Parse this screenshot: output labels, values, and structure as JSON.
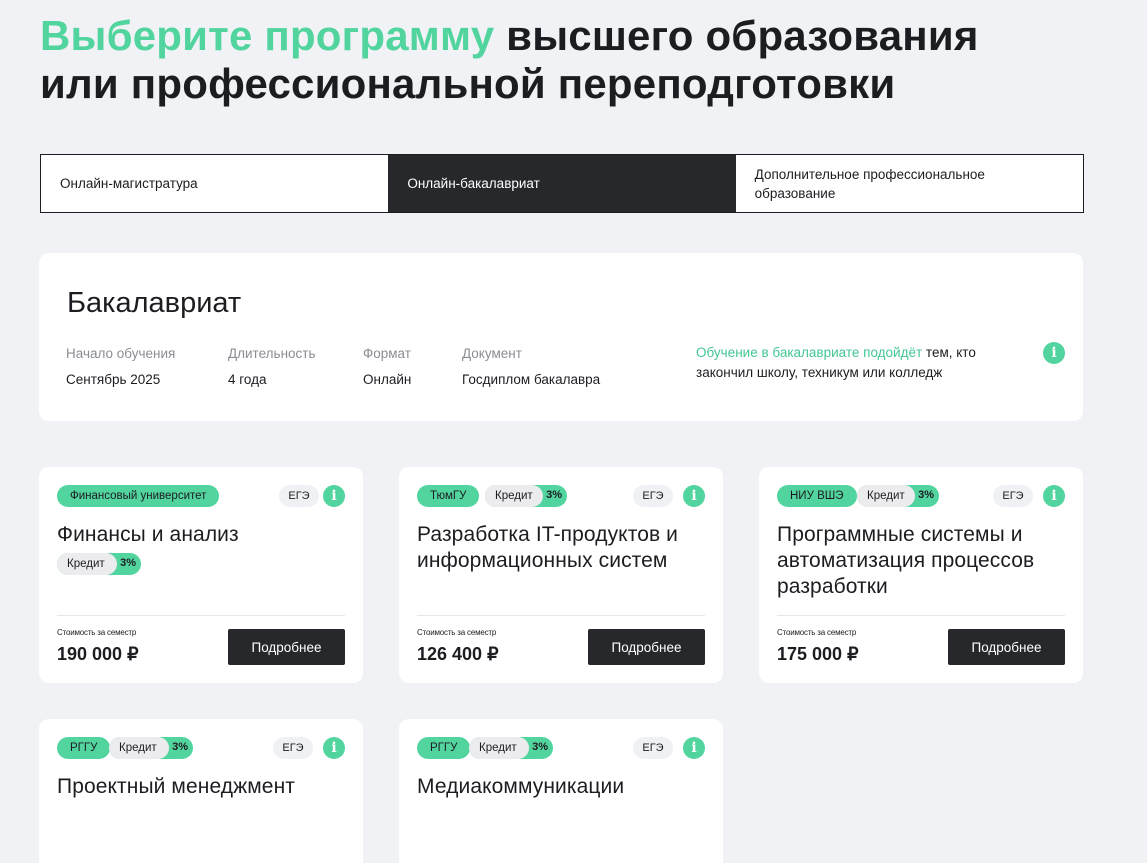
{
  "hero": {
    "accent": "Выберите программу",
    "line1_rest": " высшего образования",
    "line2": "или профессиональной переподготовки"
  },
  "tabs": [
    {
      "label": "Онлайн-магистратура",
      "active": false
    },
    {
      "label": "Онлайн-бакалавриат",
      "active": true
    },
    {
      "label": "Дополнительное профессиональное образование",
      "active": false
    }
  ],
  "program": {
    "title": "Бакалавриат",
    "start_label": "Начало обучения",
    "start_value": "Сентябрь 2025",
    "duration_label": "Длительность",
    "duration_value": "4 года",
    "format_label": "Формат",
    "format_value": "Онлайн",
    "document_label": "Документ",
    "document_value": "Госдиплом бакалавра",
    "suits_highlight": "Обучение в бакалавриате подойдёт",
    "suits_rest": " тем, кто закончил школу, техникум или колледж",
    "info_glyph": "i"
  },
  "cards": [
    {
      "university": "Финансовый университет",
      "credit_label": "Кредит",
      "credit_pct": "3%",
      "exam": "ЕГЭ",
      "title": "Финансы и анализ",
      "price_label": "Стоимость за семестр",
      "price": "190 000 ₽",
      "button": "Подробнее"
    },
    {
      "university": "ТюмГУ",
      "credit_label": "Кредит",
      "credit_pct": "3%",
      "exam": "ЕГЭ",
      "title": "Разработка IT-продуктов и информационных систем",
      "price_label": "Стоимость за семестр",
      "price": "126 400 ₽",
      "button": "Подробнее"
    },
    {
      "university": "НИУ ВШЭ",
      "credit_label": "Кредит",
      "credit_pct": "3%",
      "exam": "ЕГЭ",
      "title": "Программные системы и автоматизация процессов разработки",
      "price_label": "Стоимость за семестр",
      "price": "175 000 ₽",
      "button": "Подробнее"
    },
    {
      "university": "РГГУ",
      "credit_label": "Кредит",
      "credit_pct": "3%",
      "exam": "ЕГЭ",
      "title": "Проектный менеджмент"
    },
    {
      "university": "РГГУ",
      "credit_label": "Кредит",
      "credit_pct": "3%",
      "exam": "ЕГЭ",
      "title": "Медиакоммуникации"
    }
  ],
  "colors": {
    "accent": "#52d49f",
    "dark": "#26282c",
    "background": "#f1f2f6"
  }
}
